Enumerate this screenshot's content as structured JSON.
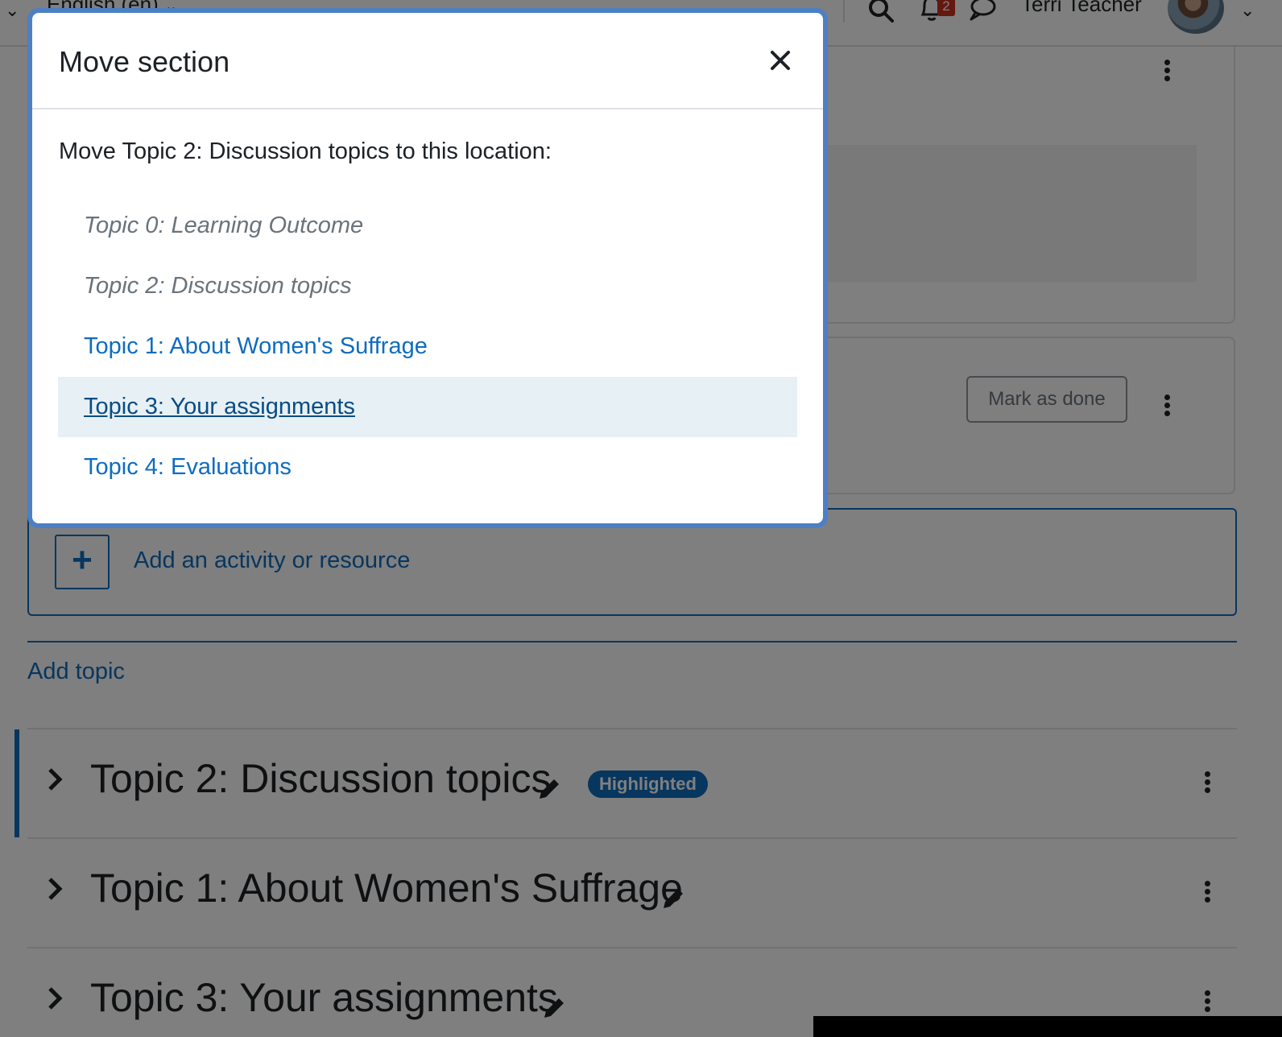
{
  "topbar": {
    "language": "English (en)",
    "notification_count": "2",
    "user_name": "Terri Teacher"
  },
  "course": {
    "mark_as_done_label": "Mark as done",
    "add_activity_label": "Add an activity or resource",
    "add_topic_label": "Add topic",
    "highlighted_badge": "Highlighted",
    "sections": [
      {
        "title": "Topic 2: Discussion topics",
        "highlighted": true
      },
      {
        "title": "Topic 1: About Women's Suffrage",
        "highlighted": false
      },
      {
        "title": "Topic 3: Your assignments",
        "highlighted": false
      }
    ]
  },
  "modal": {
    "title": "Move section",
    "prompt": "Move Topic 2: Discussion topics to this location:",
    "options": [
      {
        "label": "Topic 0: Learning Outcome",
        "state": "disabled"
      },
      {
        "label": "Topic 2: Discussion topics",
        "state": "disabled"
      },
      {
        "label": "Topic 1: About Women's Suffrage",
        "state": "link"
      },
      {
        "label": "Topic 3: Your assignments",
        "state": "active"
      },
      {
        "label": "Topic 4: Evaluations",
        "state": "link"
      }
    ]
  },
  "colors": {
    "primary": "#0f6cbf",
    "highlight_row": "#e6f0f5",
    "disabled_text": "#6a737b",
    "modal_focus_ring": "#4d7fc5",
    "badge_red": "#ca3120"
  },
  "icons": {
    "close": "close-icon",
    "search": "search-icon",
    "notifications": "bell-icon",
    "messages": "chat-icon",
    "edit": "pencil-icon",
    "expand": "chevron-right-icon",
    "menu": "kebab-menu-icon",
    "add": "plus-icon"
  }
}
